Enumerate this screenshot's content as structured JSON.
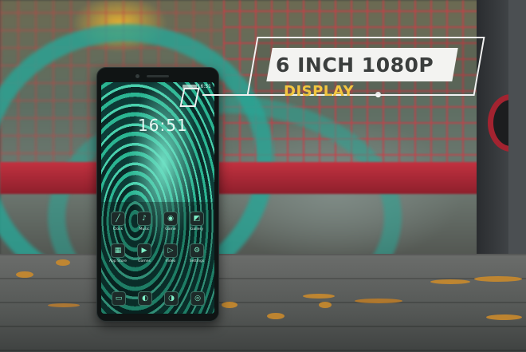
{
  "callout": {
    "title": "6 INCH 1080P",
    "subtitle": "DISPLAY"
  },
  "phone": {
    "lock_time": "16:51",
    "status_time": "16:51",
    "apps_row1": [
      {
        "label": "Clock",
        "icon": "clock-icon",
        "glyph": "╱"
      },
      {
        "label": "Music",
        "icon": "music-icon",
        "glyph": "♪"
      },
      {
        "label": "Game",
        "icon": "game-icon",
        "glyph": "◉"
      },
      {
        "label": "Gallery",
        "icon": "gallery-icon",
        "glyph": "◩"
      }
    ],
    "apps_row2": [
      {
        "label": "App Store",
        "icon": "app-store-icon",
        "glyph": "▦"
      },
      {
        "label": "Games",
        "icon": "games-icon",
        "glyph": "▶"
      },
      {
        "label": "Video",
        "icon": "video-icon",
        "glyph": "▷"
      },
      {
        "label": "Settings",
        "icon": "settings-icon",
        "glyph": "⚙"
      }
    ],
    "dock": [
      {
        "icon": "messages-icon",
        "glyph": "▭"
      },
      {
        "icon": "phone-icon",
        "glyph": "◐"
      },
      {
        "icon": "browser-icon",
        "glyph": "◑"
      },
      {
        "icon": "camera-icon",
        "glyph": "◎"
      }
    ]
  },
  "colors": {
    "callout_text": "#3b3e3d",
    "callout_sub": "#f3c640",
    "accent_green": "#2bb592",
    "railing_red": "#c23240"
  }
}
